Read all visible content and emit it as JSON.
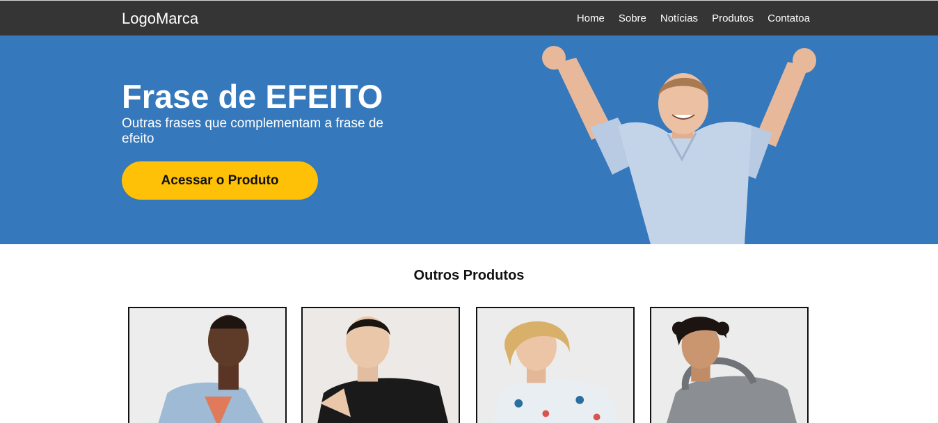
{
  "navbar": {
    "logo": "LogoMarca",
    "links": [
      {
        "label": "Home"
      },
      {
        "label": "Sobre"
      },
      {
        "label": "Notícias"
      },
      {
        "label": "Produtos"
      },
      {
        "label": "Contatoa"
      }
    ]
  },
  "hero": {
    "title": "Frase de EFEITO",
    "subtitle": "Outras frases que complementam a frase de efeito",
    "cta_label": "Acessar o Produto",
    "background_color": "#3578bb",
    "cta_color": "#ffc107"
  },
  "products": {
    "title": "Outros Produtos",
    "items": [
      {
        "name": "product-card-1"
      },
      {
        "name": "product-card-2"
      },
      {
        "name": "product-card-3"
      },
      {
        "name": "product-card-4"
      }
    ]
  }
}
